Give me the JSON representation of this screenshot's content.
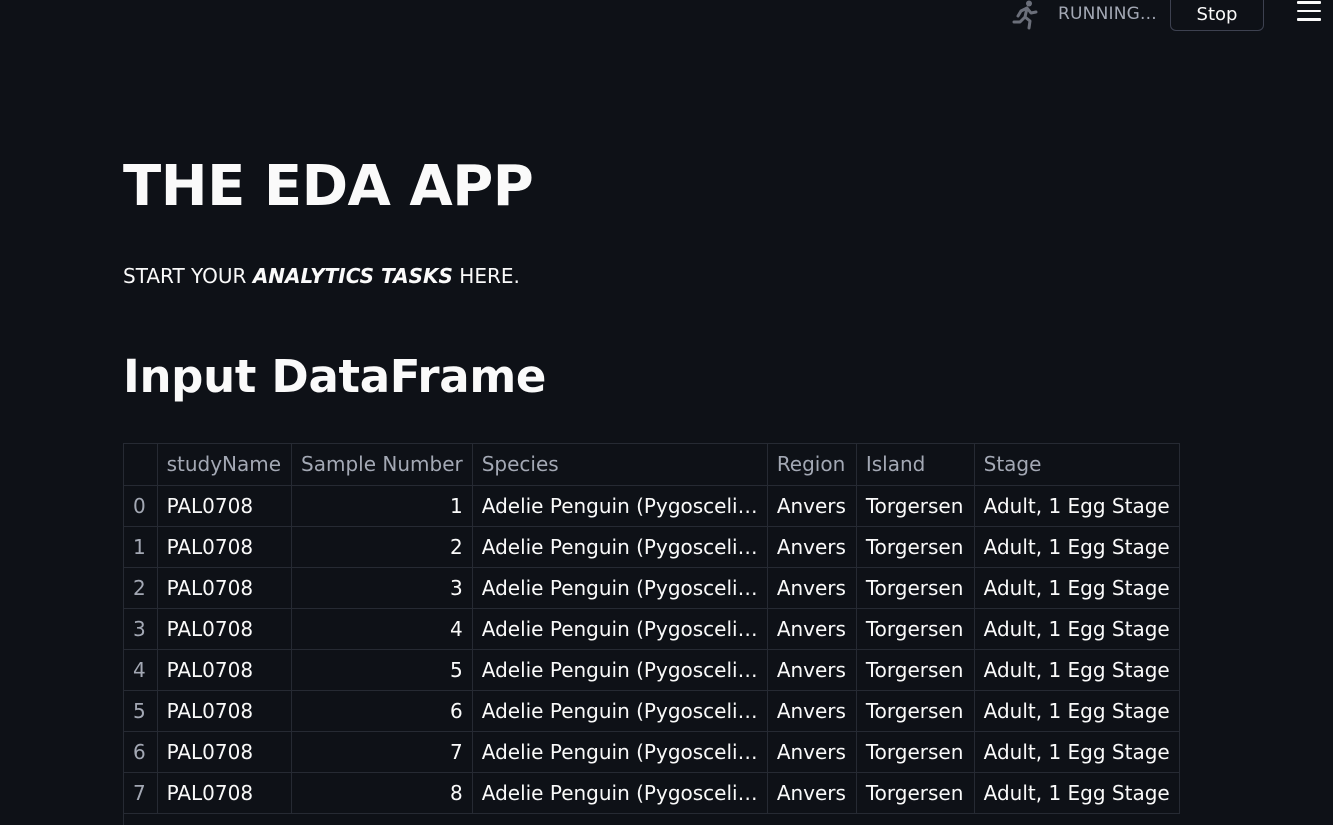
{
  "header": {
    "status_text": "RUNNING...",
    "stop_label": "Stop",
    "running_icon": "running-man-icon",
    "menu_icon": "hamburger-menu-icon"
  },
  "main": {
    "title": "THE EDA APP",
    "subtitle_prefix": "START YOUR ",
    "subtitle_emphasis": "ANALYTICS TASKS",
    "subtitle_suffix": " HERE.",
    "section_title": "Input DataFrame"
  },
  "table": {
    "columns": [
      "",
      "studyName",
      "Sample Number",
      "Species",
      "Region",
      "Island",
      "Stage"
    ],
    "rows": [
      [
        "0",
        "PAL0708",
        "1",
        "Adelie Penguin (Pygosceli…",
        "Anvers",
        "Torgersen",
        "Adult, 1 Egg Stage"
      ],
      [
        "1",
        "PAL0708",
        "2",
        "Adelie Penguin (Pygosceli…",
        "Anvers",
        "Torgersen",
        "Adult, 1 Egg Stage"
      ],
      [
        "2",
        "PAL0708",
        "3",
        "Adelie Penguin (Pygosceli…",
        "Anvers",
        "Torgersen",
        "Adult, 1 Egg Stage"
      ],
      [
        "3",
        "PAL0708",
        "4",
        "Adelie Penguin (Pygosceli…",
        "Anvers",
        "Torgersen",
        "Adult, 1 Egg Stage"
      ],
      [
        "4",
        "PAL0708",
        "5",
        "Adelie Penguin (Pygosceli…",
        "Anvers",
        "Torgersen",
        "Adult, 1 Egg Stage"
      ],
      [
        "5",
        "PAL0708",
        "6",
        "Adelie Penguin (Pygosceli…",
        "Anvers",
        "Torgersen",
        "Adult, 1 Egg Stage"
      ],
      [
        "6",
        "PAL0708",
        "7",
        "Adelie Penguin (Pygosceli…",
        "Anvers",
        "Torgersen",
        "Adult, 1 Egg Stage"
      ],
      [
        "7",
        "PAL0708",
        "8",
        "Adelie Penguin (Pygosceli…",
        "Anvers",
        "Torgersen",
        "Adult, 1 Egg Stage"
      ]
    ]
  },
  "colors": {
    "background": "#0e1117",
    "text": "#fafafa",
    "muted_text": "#a3a8b4",
    "grid_border": "#262a33"
  }
}
